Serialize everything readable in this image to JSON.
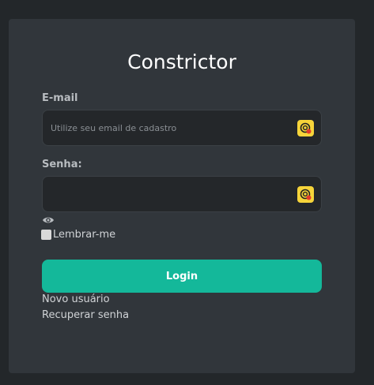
{
  "app": {
    "title": "Constrictor"
  },
  "form": {
    "email_label": "E-mail",
    "email_placeholder": "Utilize seu email de cadastro",
    "email_value": "",
    "password_label": "Senha:",
    "password_value": "",
    "show_password_icon": "eye-icon",
    "remember_label": "Lembrar-me",
    "remember_checked": false,
    "login_label": "Login"
  },
  "links": {
    "new_user": "Novo usuário",
    "recover_password": "Recuperar senha"
  },
  "colors": {
    "accent": "#14b89a",
    "card": "#31363b",
    "background": "#23272a",
    "autofill_icon": "#f6d43a"
  }
}
